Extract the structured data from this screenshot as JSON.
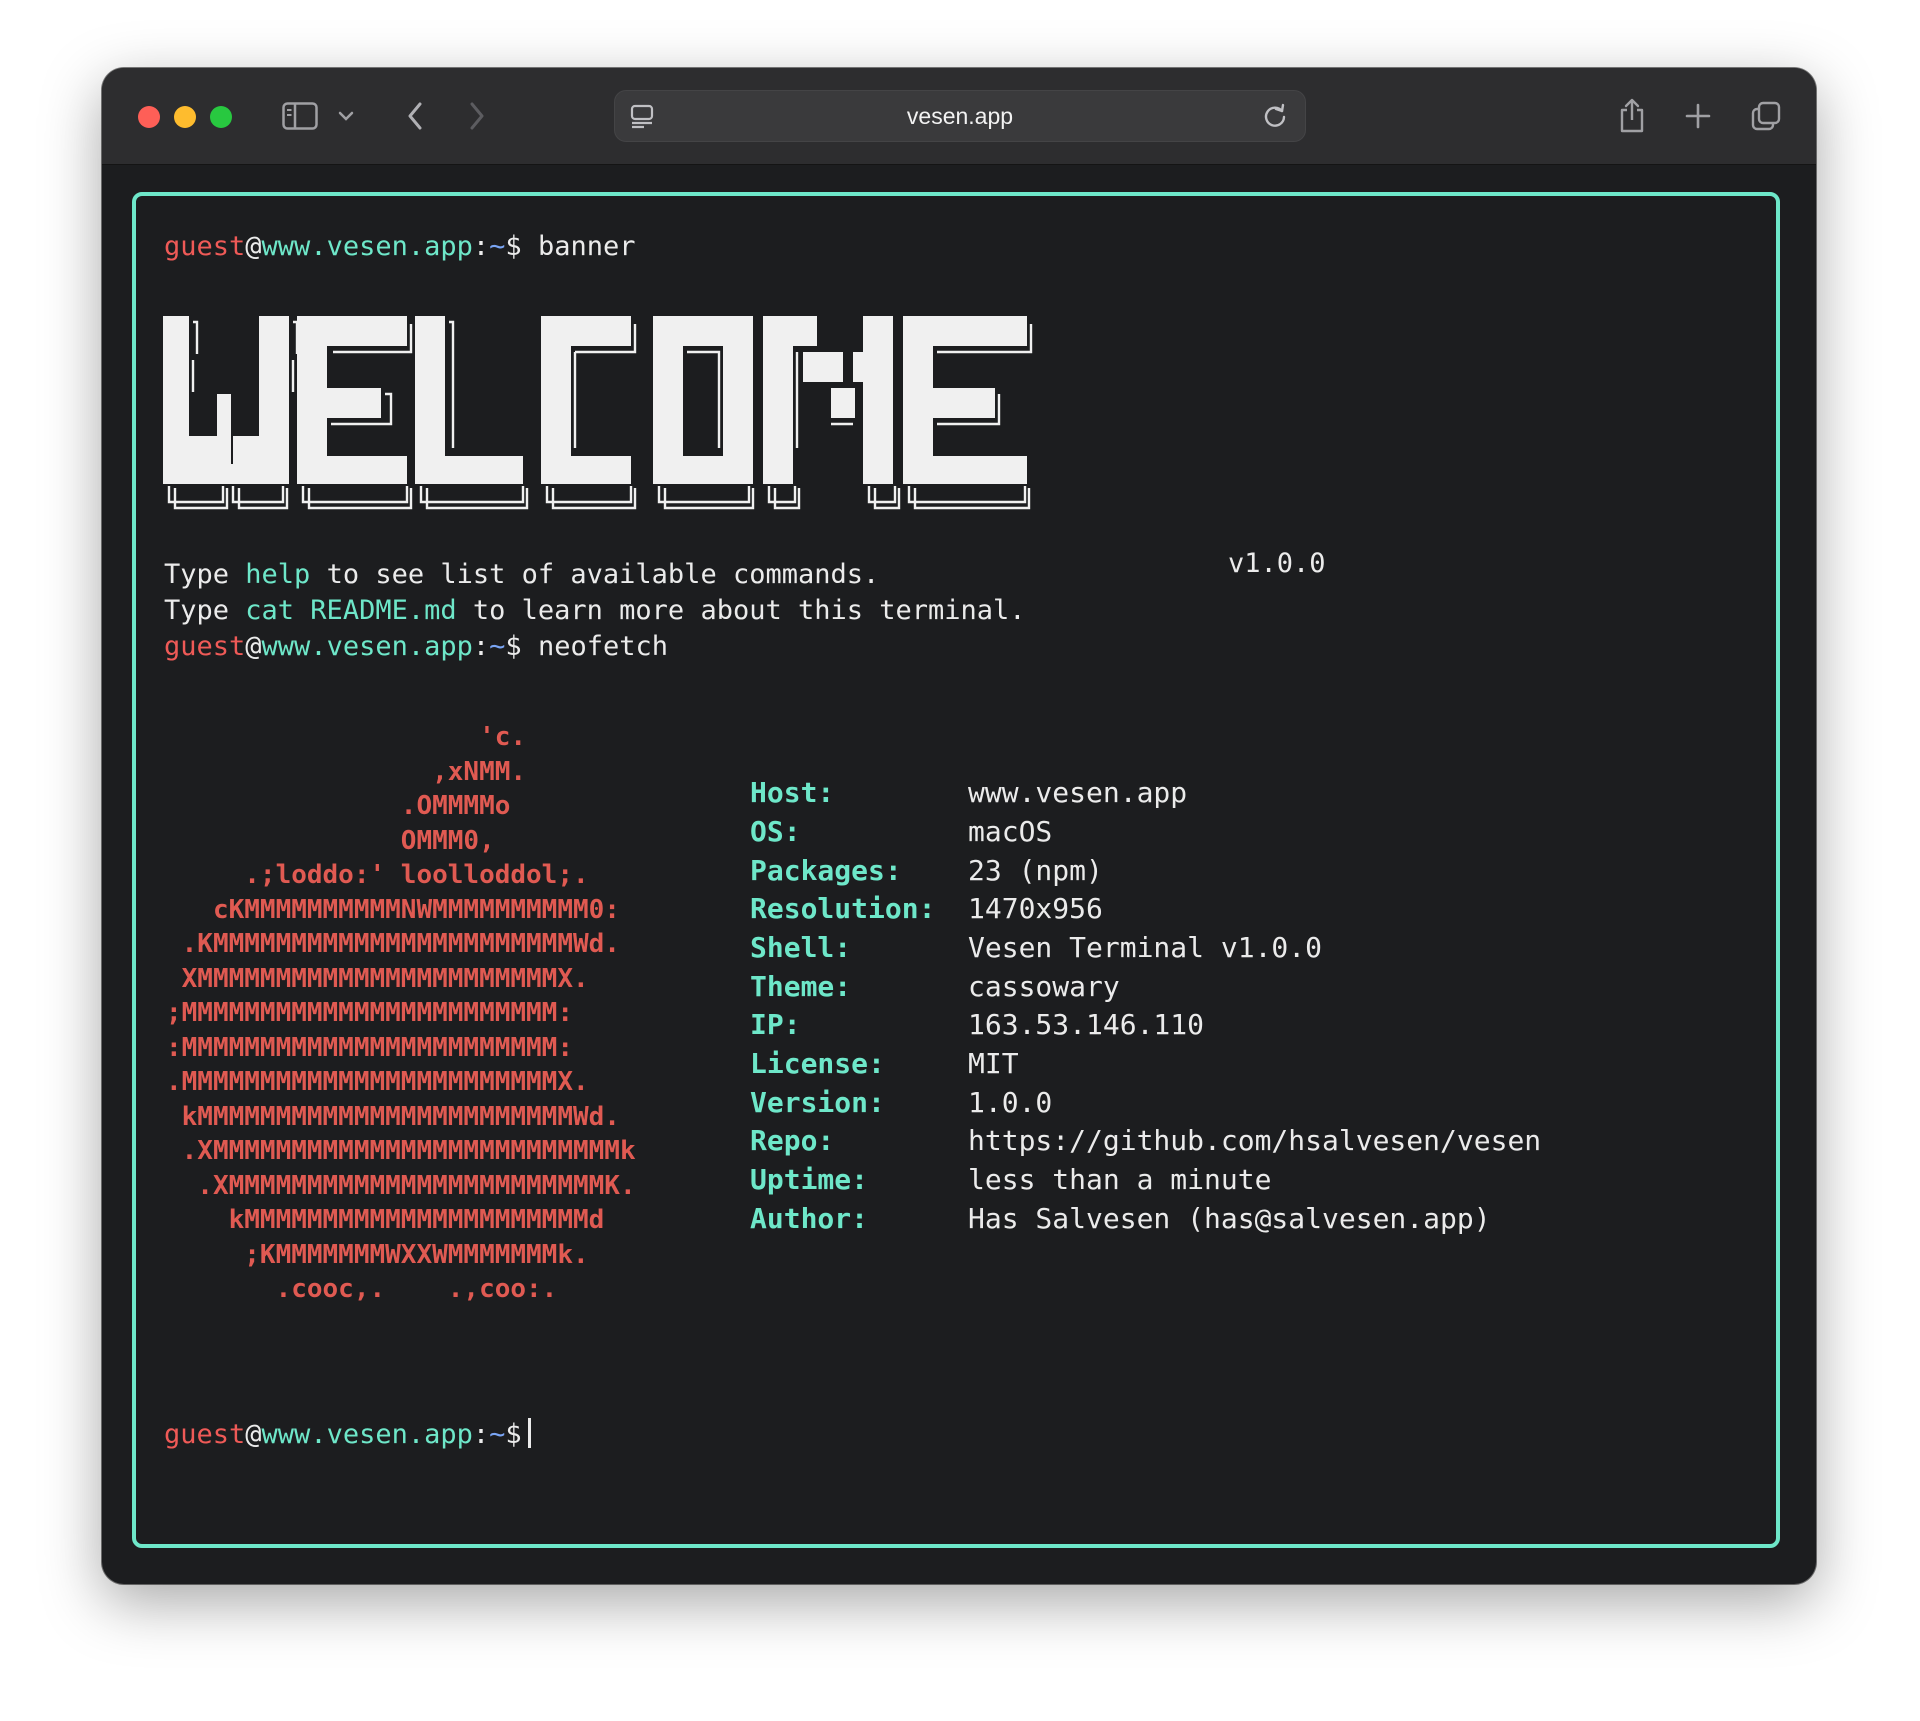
{
  "browser": {
    "url": "vesen.app"
  },
  "prompt": {
    "user": "guest",
    "at": "@",
    "host": "www.vesen.app",
    "colon": ":",
    "path": "~",
    "symbol": "$"
  },
  "commands": {
    "first": "banner",
    "second": "neofetch"
  },
  "banner": {
    "version": "v1.0.0"
  },
  "help_lines": {
    "line1_prefix": "Type ",
    "line1_keyword": "help",
    "line1_suffix": " to see list of available commands.",
    "line2_prefix": "Type ",
    "line2_keyword": "cat README.md",
    "line2_suffix": " to learn more about this terminal."
  },
  "ascii_logo": [
    "                    'c.",
    "                 ,xNMM.",
    "               .OMMMMo",
    "               OMMM0,",
    "     .;loddo:' loolloddol;.",
    "   cKMMMMMMMMMMNWMMMMMMMMMM0:",
    " .KMMMMMMMMMMMMMMMMMMMMMMMWd.",
    " XMMMMMMMMMMMMMMMMMMMMMMMX.",
    ";MMMMMMMMMMMMMMMMMMMMMMMM:",
    ":MMMMMMMMMMMMMMMMMMMMMMMM:",
    ".MMMMMMMMMMMMMMMMMMMMMMMMX.",
    " kMMMMMMMMMMMMMMMMMMMMMMMMWd.",
    " .XMMMMMMMMMMMMMMMMMMMMMMMMMMk",
    "  .XMMMMMMMMMMMMMMMMMMMMMMMMK.",
    "    kMMMMMMMMMMMMMMMMMMMMMMd",
    "     ;KMMMMMMMWXXWMMMMMMMk.",
    "       .cooc,.    .,coo:."
  ],
  "neofetch": [
    {
      "key": "Host:",
      "value": "www.vesen.app"
    },
    {
      "key": "OS:",
      "value": "macOS"
    },
    {
      "key": "Packages:",
      "value": "23 (npm)"
    },
    {
      "key": "Resolution:",
      "value": "1470x956"
    },
    {
      "key": "Shell:",
      "value": "Vesen Terminal v1.0.0"
    },
    {
      "key": "Theme:",
      "value": "cassowary"
    },
    {
      "key": "IP:",
      "value": "163.53.146.110"
    },
    {
      "key": "License:",
      "value": "MIT"
    },
    {
      "key": "Version:",
      "value": "1.0.0"
    },
    {
      "key": "Repo:",
      "value": "https://github.com/hsalvesen/vesen"
    },
    {
      "key": "Uptime:",
      "value": "less than a minute"
    },
    {
      "key": "Author:",
      "value": "Has Salvesen (has@salvesen.app)"
    }
  ],
  "colors": {
    "accent": "#6ee7c9",
    "user": "#ef5a57",
    "path": "#7aa5f5",
    "logo": "#e05a52",
    "background": "#1c1d1f"
  }
}
